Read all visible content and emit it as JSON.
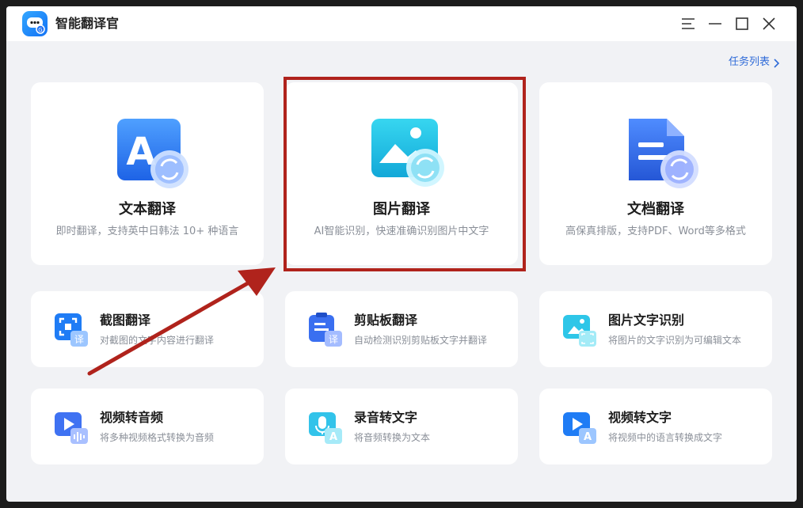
{
  "window": {
    "title": "智能翻译官",
    "controls": [
      "menu-icon",
      "minimize-icon",
      "maximize-icon",
      "close-icon"
    ]
  },
  "header": {
    "task_list_label": "任务列表"
  },
  "big_cards": [
    {
      "title": "文本翻译",
      "desc": "即时翻译，支持英中日韩法 10+ 种语言",
      "icon": "text-translate-icon"
    },
    {
      "title": "图片翻译",
      "desc": "AI智能识别，快速准确识别图片中文字",
      "icon": "image-translate-icon"
    },
    {
      "title": "文档翻译",
      "desc": "高保真排版，支持PDF、Word等多格式",
      "icon": "document-translate-icon"
    }
  ],
  "small_cards": [
    {
      "title": "截图翻译",
      "desc": "对截图的文字内容进行翻译",
      "icon": "screenshot-translate-icon",
      "badge": "译"
    },
    {
      "title": "剪贴板翻译",
      "desc": "自动检测识别剪贴板文字并翻译",
      "icon": "clipboard-translate-icon",
      "badge": "译"
    },
    {
      "title": "图片文字识别",
      "desc": "将图片的文字识别为可编辑文本",
      "icon": "image-ocr-icon",
      "badge": ""
    },
    {
      "title": "视频转音频",
      "desc": "将多种视频格式转换为音频",
      "icon": "video-to-audio-icon",
      "badge": ""
    },
    {
      "title": "录音转文字",
      "desc": "将音频转换为文本",
      "icon": "audio-to-text-icon",
      "badge": "A"
    },
    {
      "title": "视频转文字",
      "desc": "将视频中的语言转换成文字",
      "icon": "video-to-text-icon",
      "badge": "A"
    }
  ],
  "icon_glyphs": {
    "text": "A"
  },
  "colors": {
    "accent": "#2f6bd8",
    "highlight": "#b0231c",
    "card_bg": "#ffffff",
    "window_bg": "#f1f2f5"
  }
}
